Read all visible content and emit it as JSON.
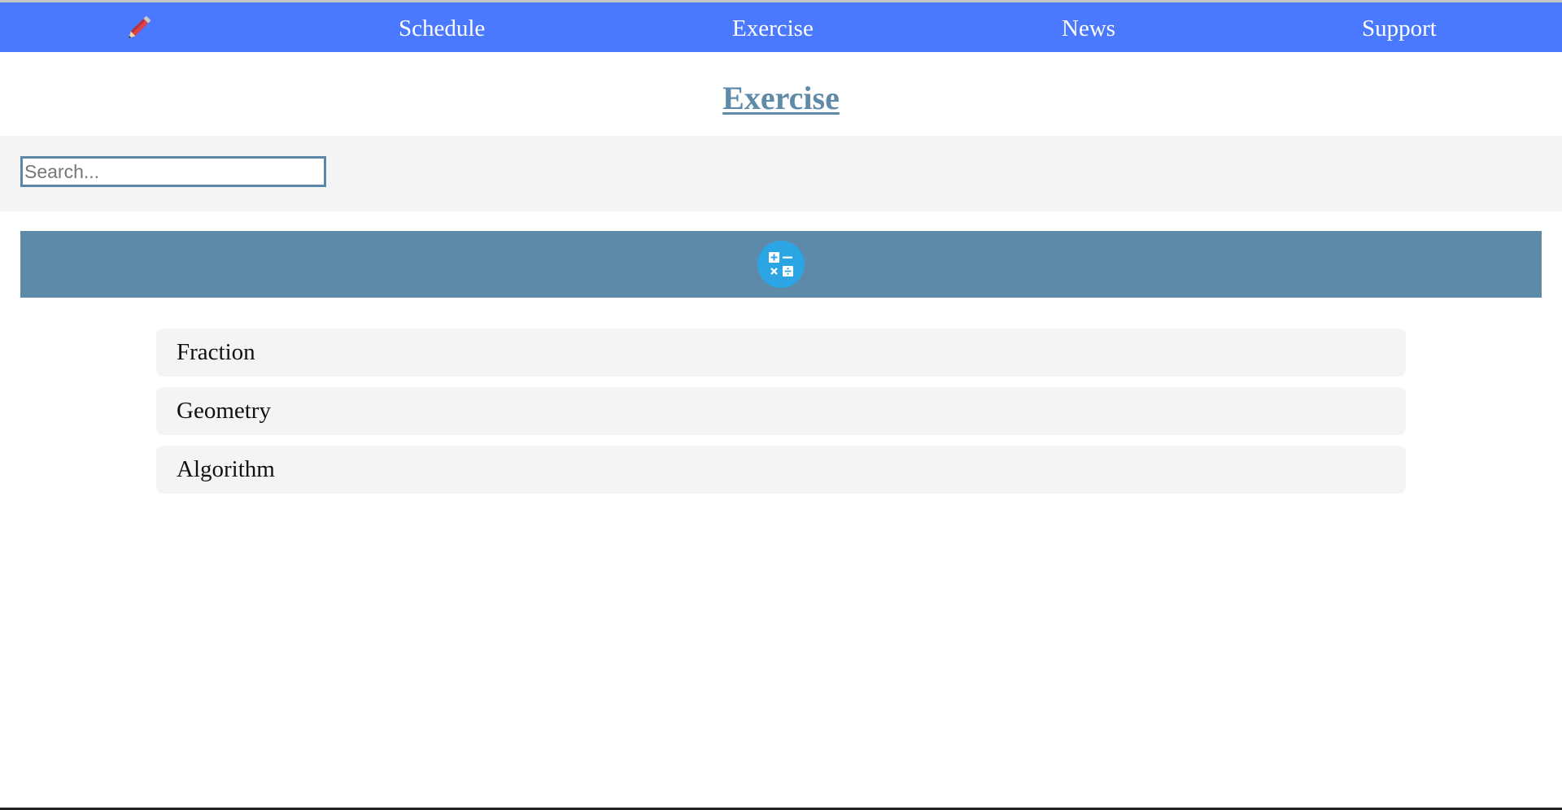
{
  "nav": {
    "logo_icon": "pencil-icon",
    "links": [
      "Schedule",
      "Exercise",
      "News",
      "Support"
    ]
  },
  "page": {
    "title": "Exercise"
  },
  "search": {
    "placeholder": "Search..."
  },
  "banner": {
    "icon": "calculator-icon"
  },
  "exercises": [
    {
      "label": "Fraction"
    },
    {
      "label": "Geometry"
    },
    {
      "label": "Algorithm"
    }
  ],
  "colors": {
    "navbar": "#4a78ff",
    "title": "#5f8aa8",
    "banner": "#5d8aa8",
    "calc_icon": "#2ba5e3",
    "list_bg": "#f4f4f4"
  }
}
